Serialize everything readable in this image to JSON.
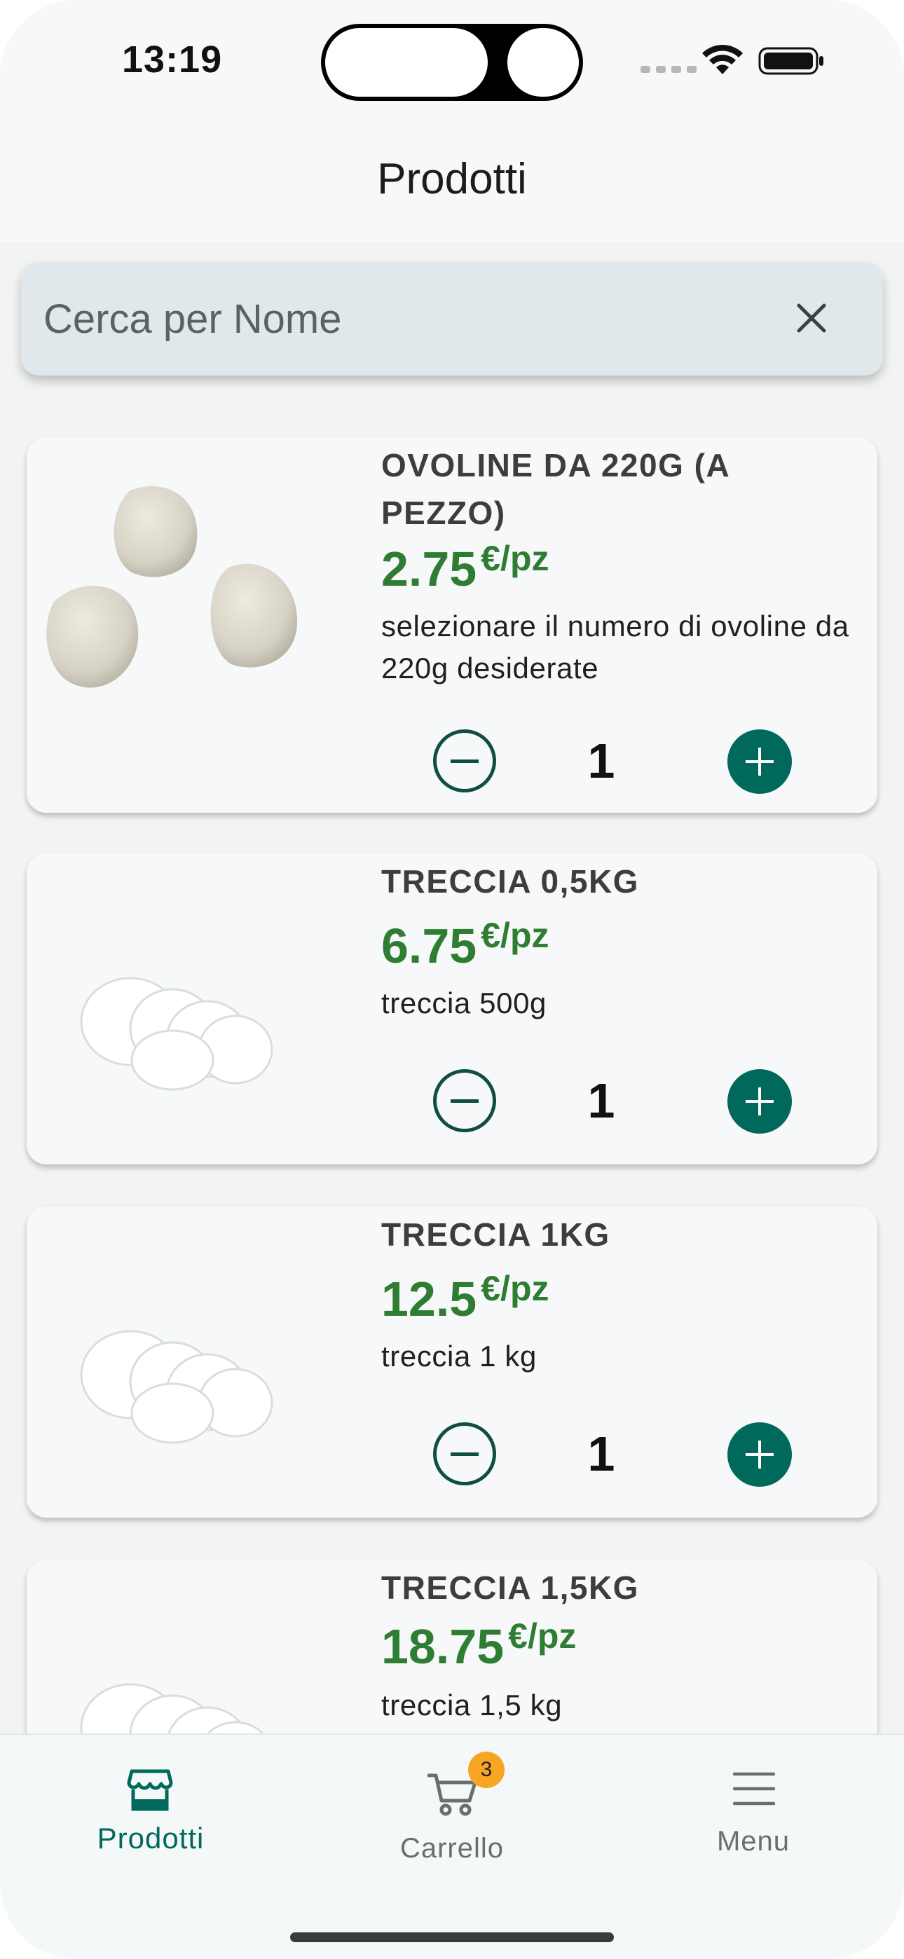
{
  "status_bar": {
    "time": "13:19"
  },
  "header": {
    "title": "Prodotti"
  },
  "search": {
    "placeholder": "Cerca per Nome",
    "value": ""
  },
  "products": [
    {
      "name": "OVOLINE DA 220G (A PEZZO)",
      "price": "2.75",
      "unit": "€/pz",
      "description": "selezionare il numero di ovoline da 220g desiderate",
      "quantity": "1"
    },
    {
      "name": "TRECCIA 0,5KG",
      "price": "6.75",
      "unit": "€/pz",
      "description": "treccia 500g",
      "quantity": "1"
    },
    {
      "name": "TRECCIA 1KG",
      "price": "12.5",
      "unit": "€/pz",
      "description": "treccia 1 kg",
      "quantity": "1"
    },
    {
      "name": "TRECCIA 1,5KG",
      "price": "18.75",
      "unit": "€/pz",
      "description": "treccia 1,5 kg"
    }
  ],
  "nav": {
    "items": [
      {
        "label": "Prodotti",
        "icon": "store-icon",
        "active": true
      },
      {
        "label": "Carrello",
        "icon": "cart-icon",
        "badge": "3"
      },
      {
        "label": "Menu",
        "icon": "menu-icon"
      }
    ]
  },
  "colors": {
    "accent": "#00695c",
    "price": "#2e7d32",
    "badge": "#f6a623"
  }
}
